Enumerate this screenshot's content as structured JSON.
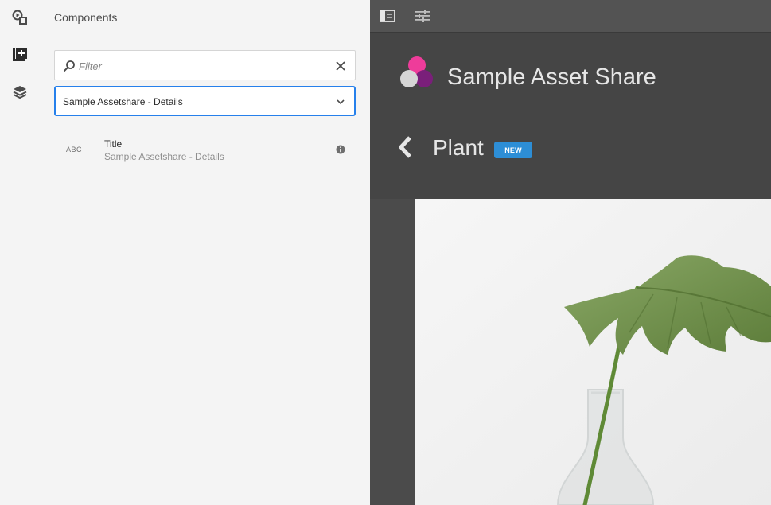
{
  "left_rail": {
    "icons": [
      "assets-icon",
      "components-icon",
      "content-tree-icon"
    ]
  },
  "panel": {
    "title": "Components",
    "filter": {
      "placeholder": "Filter",
      "value": ""
    },
    "group_select": {
      "selected": "Sample Assetshare - Details"
    },
    "components": [
      {
        "abbr": "ABC",
        "name": "Title",
        "group": "Sample Assetshare - Details"
      }
    ]
  },
  "editor": {
    "toolbar": {
      "icons": [
        "toggle-side-panel-icon",
        "page-properties-icon"
      ]
    },
    "site": {
      "title": "Sample Asset Share",
      "asset_title": "Plant",
      "badge": "NEW"
    },
    "colors": {
      "badge": "#2d8ed6",
      "logo_pink": "#ee3c9a",
      "logo_purple": "#7a1f7a",
      "logo_grey": "#d6d6d6"
    }
  }
}
